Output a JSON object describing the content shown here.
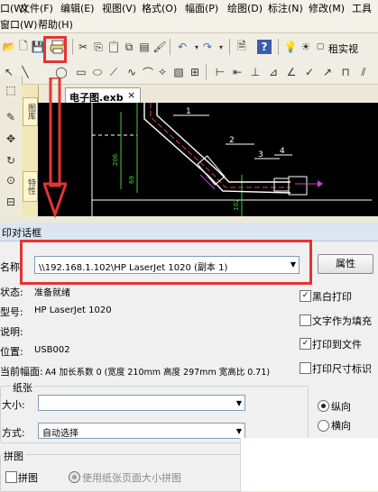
{
  "menubar": {
    "items": [
      "口(W)",
      "文件(F)",
      "编辑(E)",
      "视图(V)",
      "格式(O)",
      "幅面(P)",
      "绘图(D)",
      "标注(N)",
      "修改(M)",
      "工具"
    ],
    "row2": [
      "窗口(W)",
      "帮助(H)"
    ]
  },
  "toolbar": {
    "text_style_label": "租实视"
  },
  "sidebar": {
    "tabs": [
      "图库",
      "特性"
    ]
  },
  "document": {
    "tab_title": "电子图.exb",
    "close_glyph": "×",
    "callouts": [
      "1",
      "2",
      "3",
      "4"
    ],
    "dim_labels": [
      "206",
      "69",
      "102"
    ]
  },
  "dialog": {
    "title": "印对话框",
    "name_label": "名称:",
    "printer_name": "\\\\192.168.1.102\\HP LaserJet 1020 (副本 1)",
    "properties_button": "属性",
    "status_label": "状态:",
    "status_value": "准备就绪",
    "model_label": "型号:",
    "model_value": "HP LaserJet 1020",
    "comment_label": "说明:",
    "location_label": "位置:",
    "location_value": "USB002",
    "current_size_label": "当前幅面:",
    "current_size_value": "A4 加长系数 0   (宽度 210mm  高度 297mm  宽高比 0.71)",
    "checkboxes": [
      {
        "label": "黑白打印",
        "checked": true
      },
      {
        "label": "文字作为填充",
        "checked": false
      },
      {
        "label": "打印到文件",
        "checked": true
      },
      {
        "label": "打印尺寸标识",
        "checked": false
      }
    ],
    "paper_group_title": "纸张",
    "size_label": "大小:",
    "size_value": "",
    "source_label": "方式:",
    "source_value": "自动选择",
    "orientation": {
      "portrait": "纵向",
      "landscape": "横向",
      "selected": "portrait"
    },
    "tile_group_title": "拼图",
    "tile_checkbox": "拼图",
    "tile_radio": "使用纸张页面大小拼图"
  },
  "colors": {
    "highlight_red": "#e53333",
    "canvas_bg": "#000000",
    "dialog_bg": "#f0f0f0"
  }
}
